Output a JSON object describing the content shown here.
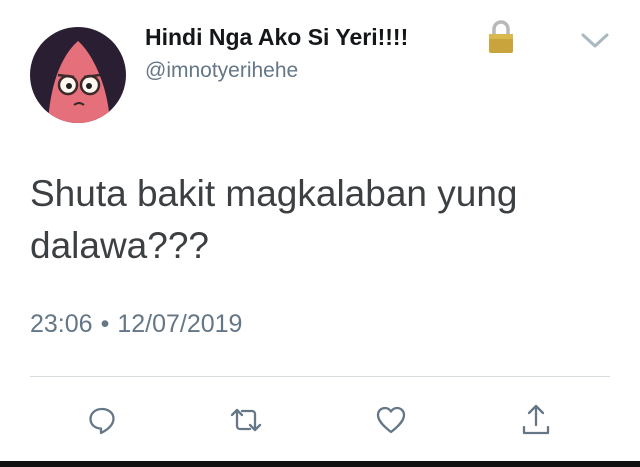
{
  "user": {
    "display_name": "Hindi Nga Ako Si Yeri!!!!",
    "handle": "@imnotyerihehe",
    "protected_icon": "lock-icon"
  },
  "tweet": {
    "text": "Shuta bakit magkalaban yung dalawa???",
    "time": "23:06",
    "separator": "•",
    "date": "12/07/2019"
  },
  "actions": [
    {
      "name": "reply",
      "icon": "reply-icon"
    },
    {
      "name": "retweet",
      "icon": "retweet-icon"
    },
    {
      "name": "like",
      "icon": "heart-icon"
    },
    {
      "name": "share",
      "icon": "share-icon"
    }
  ],
  "colors": {
    "text_primary": "#14171a",
    "text_secondary": "#657786",
    "icon": "#657786",
    "avatar_bg": "#2a1e33",
    "avatar_face": "#e5707b"
  }
}
